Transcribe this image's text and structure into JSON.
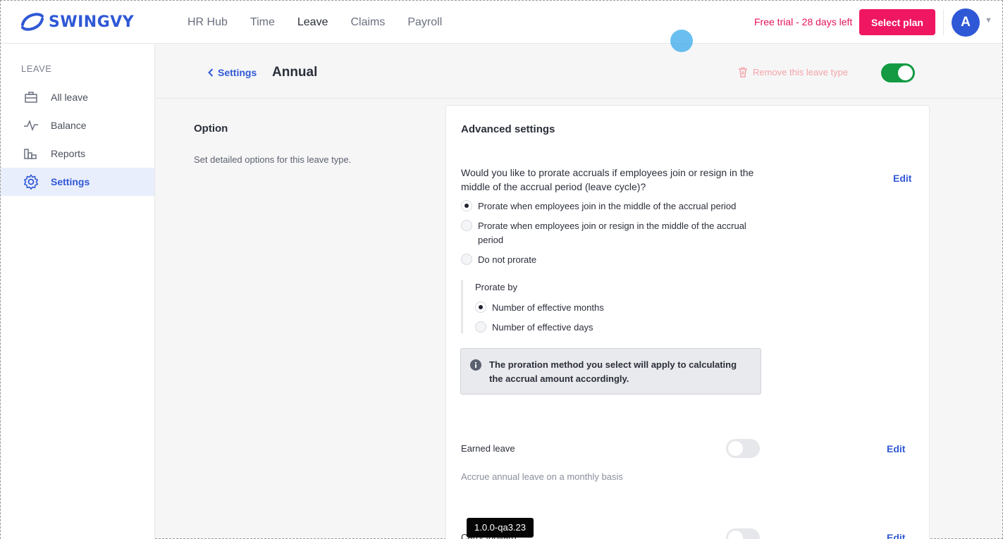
{
  "brand": {
    "name": "SWINGVY",
    "color": "#2f58d6"
  },
  "nav": {
    "items": [
      {
        "label": "HR Hub"
      },
      {
        "label": "Time"
      },
      {
        "label": "Leave"
      },
      {
        "label": "Claims"
      },
      {
        "label": "Payroll"
      }
    ]
  },
  "header": {
    "trial_text": "Free trial - 28 days left",
    "select_plan_label": "Select plan",
    "avatar_initial": "A"
  },
  "sidebar": {
    "heading": "LEAVE",
    "items": [
      {
        "label": "All leave",
        "icon": "briefcase-icon"
      },
      {
        "label": "Balance",
        "icon": "activity-icon"
      },
      {
        "label": "Reports",
        "icon": "bar-chart-icon"
      },
      {
        "label": "Settings",
        "icon": "gear-icon"
      }
    ]
  },
  "page": {
    "back_label": "Settings",
    "title": "Annual",
    "remove_label": "Remove this leave type"
  },
  "option": {
    "title": "Option",
    "description": "Set detailed options for this leave type."
  },
  "advanced": {
    "title": "Advanced settings",
    "question": "Would you like to prorate accruals if employees join or resign in the middle of the accrual period (leave cycle)?",
    "edit_label": "Edit",
    "prorate_options": [
      {
        "label": "Prorate when employees join in the middle of the accrual period",
        "checked": true
      },
      {
        "label": "Prorate when employees join or resign in the middle of the accrual period",
        "checked": false
      },
      {
        "label": "Do not prorate",
        "checked": false
      }
    ],
    "prorate_by_label": "Prorate by",
    "prorate_by_options": [
      {
        "label": "Number of effective months",
        "checked": true
      },
      {
        "label": "Number of effective days",
        "checked": false
      }
    ],
    "info_text": "The proration method you select will apply to calculating the accrual amount accordingly.",
    "earned_leave": {
      "label": "Earned leave",
      "description": "Accrue annual leave on a monthly basis",
      "edit_label": "Edit"
    },
    "carry_forward": {
      "label": "Carry forward",
      "edit_label": "Edit"
    }
  },
  "version": "1.0.0-qa3.23"
}
